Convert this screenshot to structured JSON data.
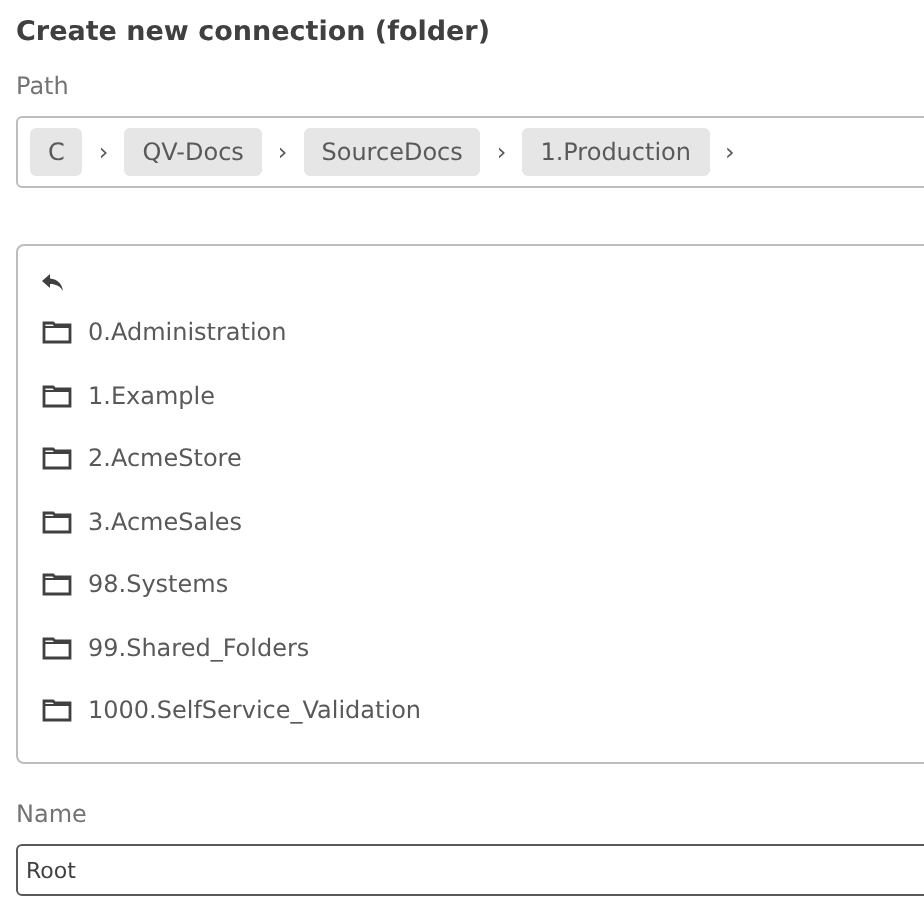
{
  "title": "Create new connection (folder)",
  "path": {
    "label": "Path",
    "segments": [
      "C",
      "QV-Docs",
      "SourceDocs",
      "1.Production"
    ],
    "separator": "›"
  },
  "folders": [
    "0.Administration",
    "1.Example",
    "2.AcmeStore",
    "3.AcmeSales",
    "98.Systems",
    "99.Shared_Folders",
    "1000.SelfService_Validation"
  ],
  "name": {
    "label": "Name",
    "value": "Root"
  }
}
